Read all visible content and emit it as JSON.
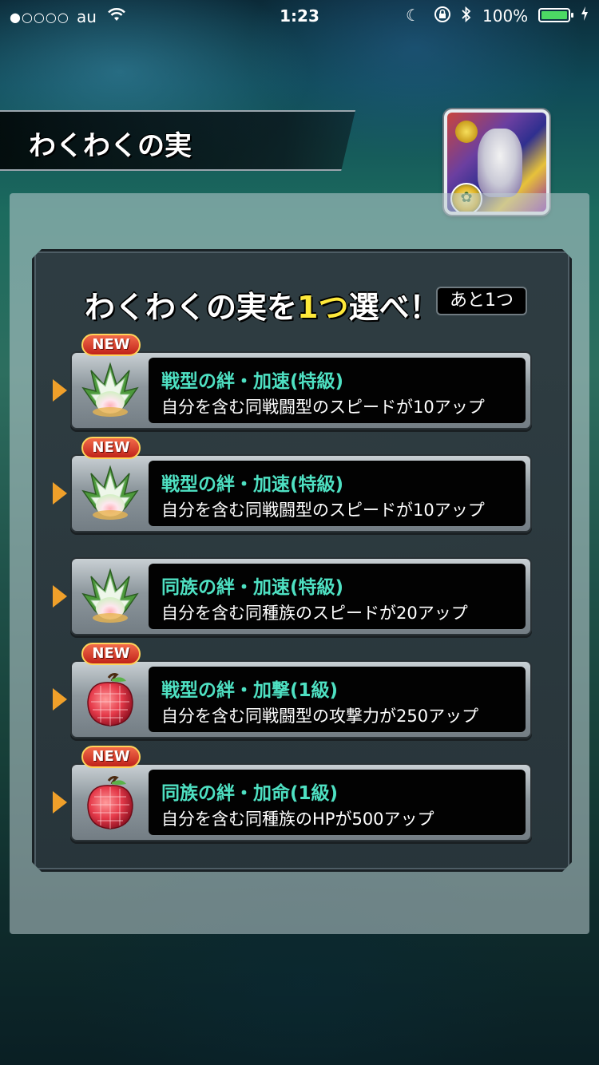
{
  "status_bar": {
    "signal": "●○○○○",
    "carrier": "au",
    "time": "1:23",
    "battery_percent": "100%",
    "battery_level": 1.0
  },
  "header": {
    "title": "わくわくの実"
  },
  "panel": {
    "heading_prefix": "わくわくの実を",
    "heading_highlight": "1つ",
    "heading_suffix": "選べ！",
    "remaining": "あと1つ"
  },
  "choices": [
    {
      "new_label": "NEW",
      "is_new": true,
      "fruit": "white-lotus-fruit",
      "name": "戦型の絆・加速(特級)",
      "description": "自分を含む同戦闘型のスピードが10アップ"
    },
    {
      "new_label": "NEW",
      "is_new": true,
      "fruit": "white-lotus-fruit",
      "name": "戦型の絆・加速(特級)",
      "description": "自分を含む同戦闘型のスピードが10アップ"
    },
    {
      "new_label": "",
      "is_new": false,
      "fruit": "white-lotus-fruit",
      "name": "同族の絆・加速(特級)",
      "description": "自分を含む同種族のスピードが20アップ"
    },
    {
      "new_label": "NEW",
      "is_new": true,
      "fruit": "red-fruit",
      "name": "戦型の絆・加撃(1級)",
      "description": "自分を含む同戦闘型の攻撃力が250アップ"
    },
    {
      "new_label": "NEW",
      "is_new": true,
      "fruit": "red-fruit",
      "name": "同族の絆・加命(1級)",
      "description": "自分を含む同種族のHPが500アップ"
    }
  ],
  "colors": {
    "choice_name": "#4ee0c2",
    "highlight": "#ffe93a",
    "arrow": "#f0a02a",
    "new_badge": "#c0221a"
  }
}
